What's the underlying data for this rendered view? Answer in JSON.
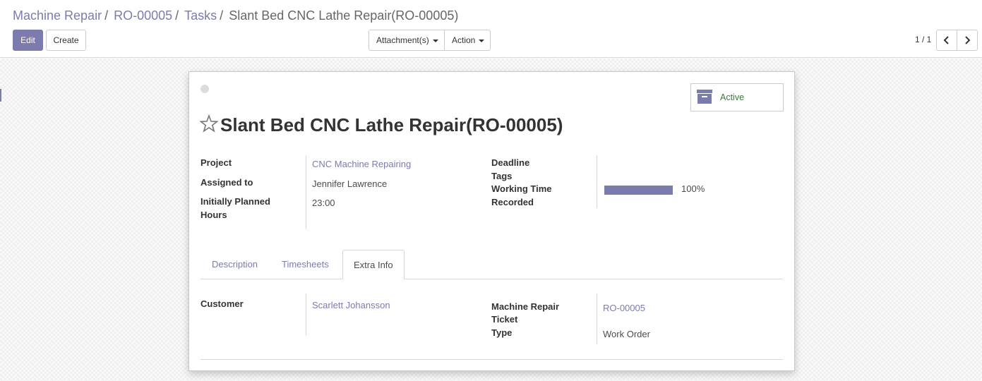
{
  "breadcrumb": [
    {
      "label": "Machine Repair"
    },
    {
      "label": "RO-00005"
    },
    {
      "label": "Tasks"
    }
  ],
  "breadcrumb_separator": "/",
  "breadcrumb_current": "Slant Bed CNC Lathe Repair(RO-00005)",
  "buttons": {
    "edit": "Edit",
    "create": "Create"
  },
  "dropdowns": {
    "attachments": "Attachment(s)",
    "action": "Action"
  },
  "pager": {
    "value": "1 / 1"
  },
  "status": {
    "label": "Active"
  },
  "task_title": "Slant Bed CNC Lathe Repair(RO-00005)",
  "fields_left": {
    "project_label": "Project",
    "project_value": "CNC Machine Repairing",
    "assigned_label": "Assigned to",
    "assigned_value": "Jennifer Lawrence",
    "planned_label_1": "Initially Planned",
    "planned_label_2": "Hours",
    "planned_value": "23:00"
  },
  "fields_right": {
    "deadline_label": "Deadline",
    "tags_label": "Tags",
    "working_time_label_1": "Working Time",
    "working_time_label_2": "Recorded",
    "working_time_percent": 100,
    "working_time_text": "100%"
  },
  "tabs": [
    {
      "label": "Description",
      "active": false
    },
    {
      "label": "Timesheets",
      "active": false
    },
    {
      "label": "Extra Info",
      "active": true
    }
  ],
  "extra_info": {
    "customer_label": "Customer",
    "customer_value": "Scarlett Johansson",
    "ticket_label_1": "Machine Repair",
    "ticket_label_2": "Ticket",
    "ticket_value": "RO-00005",
    "type_label": "Type",
    "type_value": "Work Order"
  },
  "colors": {
    "accent": "#7c7bad",
    "active_status": "#2e7d32"
  }
}
